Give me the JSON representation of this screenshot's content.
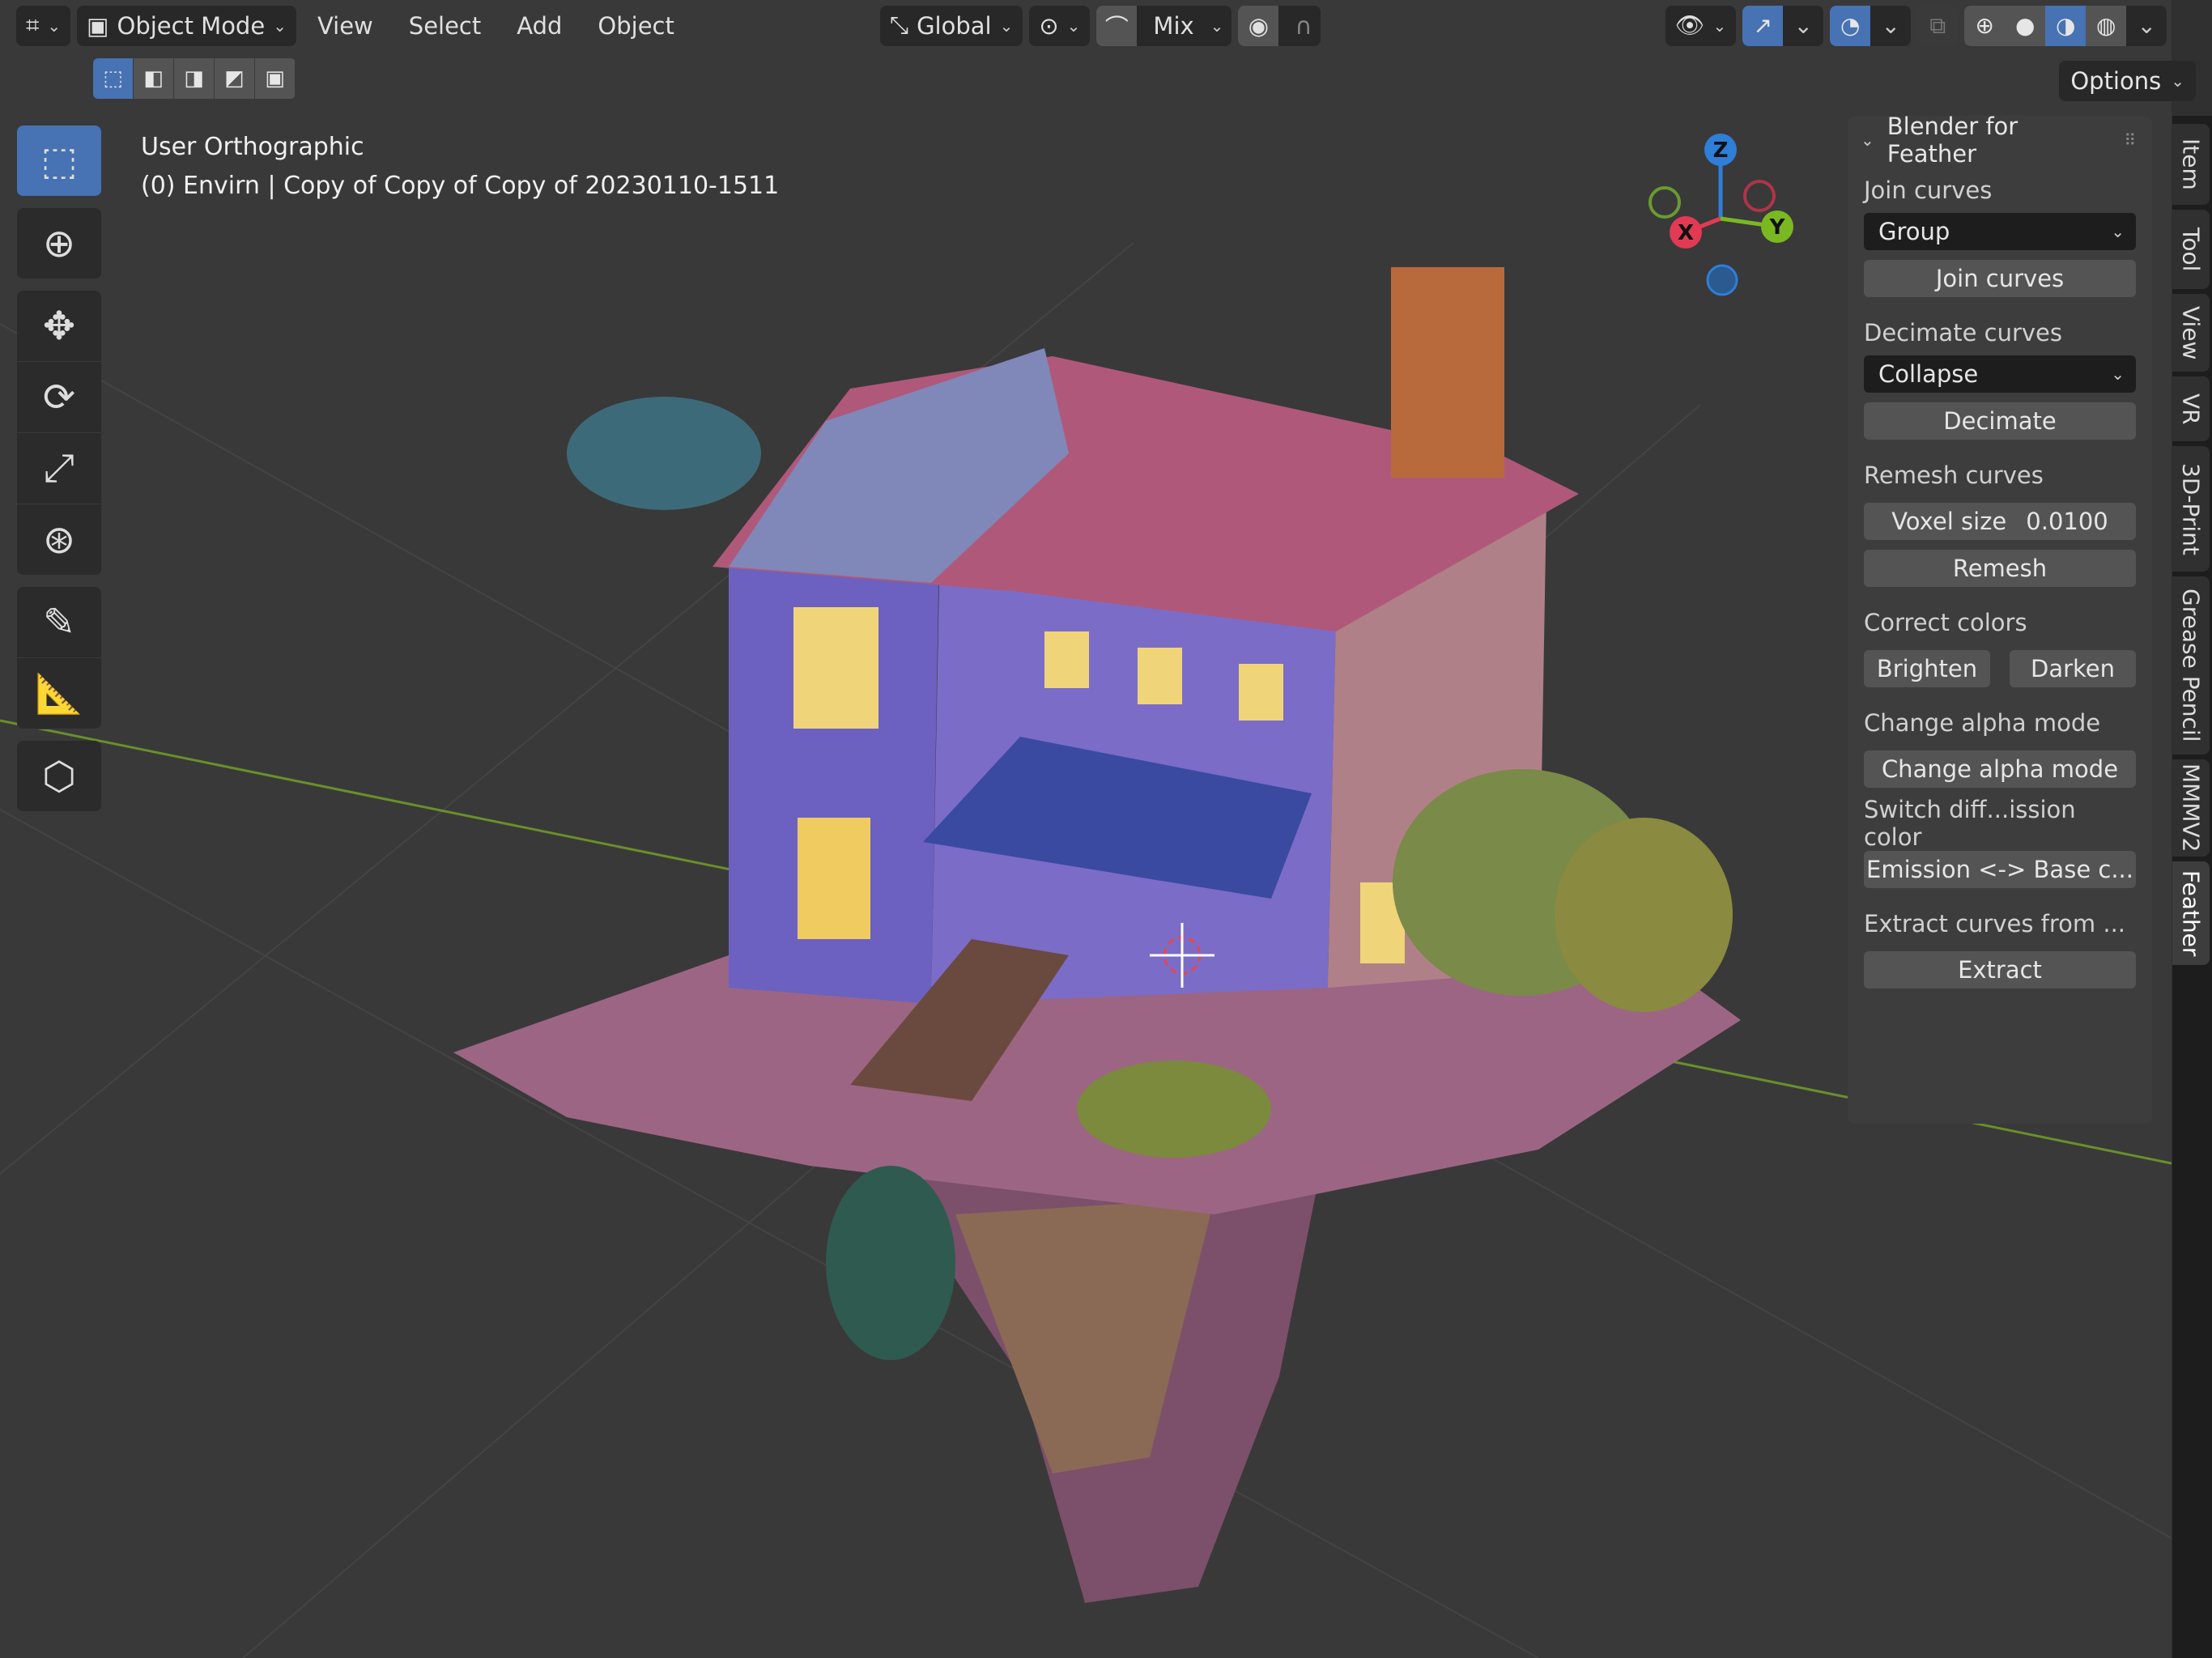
{
  "header": {
    "editor_icon": "editor-type-icon",
    "mode": "Object Mode",
    "menus": [
      "View",
      "Select",
      "Add",
      "Object"
    ],
    "orientation": "Global",
    "pivot": "pivot-icon",
    "snap": "snap-icon",
    "mix": "Mix",
    "proportional": "proportional-icon",
    "falloff": "falloff-icon",
    "options": "Options"
  },
  "viewport": {
    "view_name": "User Orthographic",
    "object_info": "(0) Envirn | Copy of Copy of Copy of 20230110-1511",
    "gizmo": {
      "x": "X",
      "y": "Y",
      "z": "Z"
    }
  },
  "toolbar": [
    "select-box",
    "cursor",
    "move",
    "rotate",
    "scale",
    "transform",
    "annotate",
    "measure",
    "add-cube"
  ],
  "panel": {
    "title": "Blender for Feather",
    "join_label": "Join curves",
    "join_mode": "Group",
    "join_button": "Join curves",
    "decimate_label": "Decimate curves",
    "decimate_mode": "Collapse",
    "decimate_button": "Decimate",
    "remesh_label": "Remesh curves",
    "voxel_label": "Voxel size",
    "voxel_value": "0.0100",
    "remesh_button": "Remesh",
    "colors_label": "Correct colors",
    "brighten": "Brighten",
    "darken": "Darken",
    "alpha_label": "Change alpha mode",
    "alpha_button": "Change alpha mode",
    "switch_label": "Switch diff...ission color",
    "switch_button": "Emission <-> Base c...",
    "extract_label": "Extract curves from ...",
    "extract_button": "Extract"
  },
  "tabs": [
    "Item",
    "Tool",
    "View",
    "VR",
    "3D-Print",
    "Grease Pencil",
    "MMMV2",
    "Feather"
  ],
  "active_tab": "Feather",
  "colors": {
    "accent": "#4772b3",
    "bg": "#393939"
  }
}
